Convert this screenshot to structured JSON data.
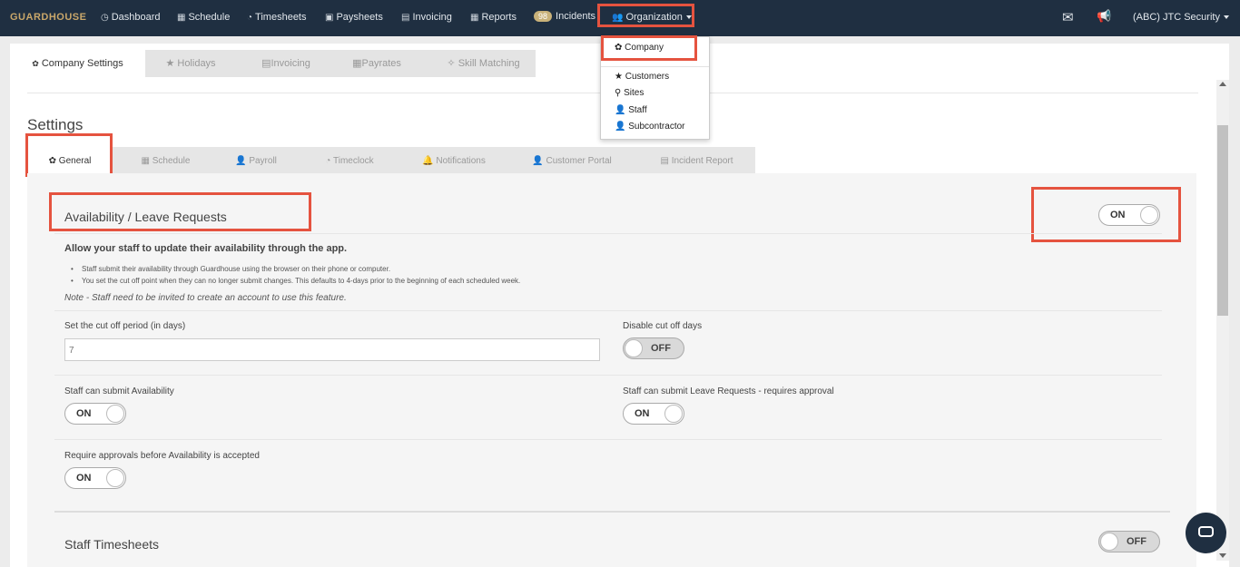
{
  "nav": {
    "brand": "GUARDHOUSE",
    "items": [
      {
        "label": "Dashboard",
        "icon": "dashboard-icon",
        "glyph": "◷"
      },
      {
        "label": "Schedule",
        "icon": "calendar-icon",
        "glyph": "▦"
      },
      {
        "label": "Timesheets",
        "icon": "clock-icon",
        "glyph": "◔"
      },
      {
        "label": "Paysheets",
        "icon": "money-icon",
        "glyph": "▣"
      },
      {
        "label": "Invoicing",
        "icon": "invoice-icon",
        "glyph": "▤"
      },
      {
        "label": "Reports",
        "icon": "table-icon",
        "glyph": "▦"
      }
    ],
    "incidents_badge": "98",
    "incidents_label": "Incidents",
    "organization_label": "Organization",
    "account_label": "(ABC) JTC Security",
    "envelope_glyph": "✉",
    "megaphone_glyph": "📢"
  },
  "org_menu": {
    "items": [
      {
        "label": "Company",
        "glyph": "✿"
      },
      {
        "label": "Customers",
        "glyph": "★"
      },
      {
        "label": "Sites",
        "glyph": "⚲"
      },
      {
        "label": "Staff",
        "glyph": "👤"
      },
      {
        "label": "Subcontractor",
        "glyph": "👤"
      }
    ]
  },
  "company_tabs": [
    {
      "label": "Company Settings",
      "glyph": "✿"
    },
    {
      "label": "Holidays",
      "glyph": "★"
    },
    {
      "label": "Invoicing",
      "glyph": "▤"
    },
    {
      "label": "Payrates",
      "glyph": "▦"
    },
    {
      "label": "Skill Matching",
      "glyph": "✧"
    }
  ],
  "settings_title": "Settings",
  "settings_tabs": [
    {
      "label": "General",
      "glyph": "✿"
    },
    {
      "label": "Schedule",
      "glyph": "▦"
    },
    {
      "label": "Payroll",
      "glyph": "👤"
    },
    {
      "label": "Timeclock",
      "glyph": "◔"
    },
    {
      "label": "Notifications",
      "glyph": "🔔"
    },
    {
      "label": "Customer Portal",
      "glyph": "👤"
    },
    {
      "label": "Incident Report",
      "glyph": "▤"
    }
  ],
  "availability": {
    "title": "Availability / Leave Requests",
    "toggle": "ON",
    "intro": "Allow your staff to update their availability through the app.",
    "bullets": [
      "Staff submit their availability through Guardhouse using the browser on their phone or computer.",
      "You set the cut off point when they can no longer submit changes. This defaults to 4-days prior to the beginning of each scheduled week."
    ],
    "note": "Note - Staff need to be invited to create an account to use this feature.",
    "cutoff_label": "Set the cut off period (in days)",
    "cutoff_value": "7",
    "disable_cutoff_label": "Disable cut off days",
    "disable_cutoff_toggle": "OFF",
    "submit_availability_label": "Staff can submit Availability",
    "submit_availability_toggle": "ON",
    "submit_leave_label": "Staff can submit Leave Requests - requires approval",
    "submit_leave_toggle": "ON",
    "require_approvals_label": "Require approvals before Availability is accepted",
    "require_approvals_toggle": "ON"
  },
  "timesheets": {
    "title": "Staff Timesheets",
    "toggle": "OFF"
  },
  "colors": {
    "nav_bg": "#1f2f41",
    "highlight": "#e5533f",
    "brand": "#c9a76a"
  }
}
